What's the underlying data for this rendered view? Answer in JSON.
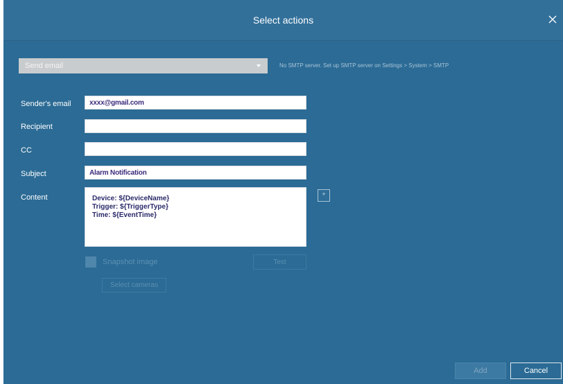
{
  "dialog": {
    "title": "Select actions",
    "close_icon": "close-icon"
  },
  "action_select": {
    "value": "Send email",
    "icon": "chevron-down-icon"
  },
  "smtp_note": "No SMTP server. Set up SMTP server on Settings > System > SMTP",
  "fields": {
    "sender_label": "Sender's email",
    "sender_value": "xxxx@gmail.com",
    "recipient_label": "Recipient",
    "recipient_value": "",
    "cc_label": "CC",
    "cc_value": "",
    "subject_label": "Subject",
    "subject_value": "Alarm Notification",
    "content_label": "Content",
    "content_lines": [
      "Device: ${DeviceName}",
      "Trigger: ${TriggerType}",
      "Time: ${EventTime}"
    ]
  },
  "insert_icon": "plus-icon",
  "snapshot_label": "Snapshot image",
  "test_label": "Test",
  "select_cameras_label": "Select cameras",
  "footer": {
    "add_label": "Add",
    "cancel_label": "Cancel"
  },
  "colors": {
    "background": "#2b6b95",
    "titlebar": "#32709a",
    "select_bg": "#c9ccce"
  }
}
